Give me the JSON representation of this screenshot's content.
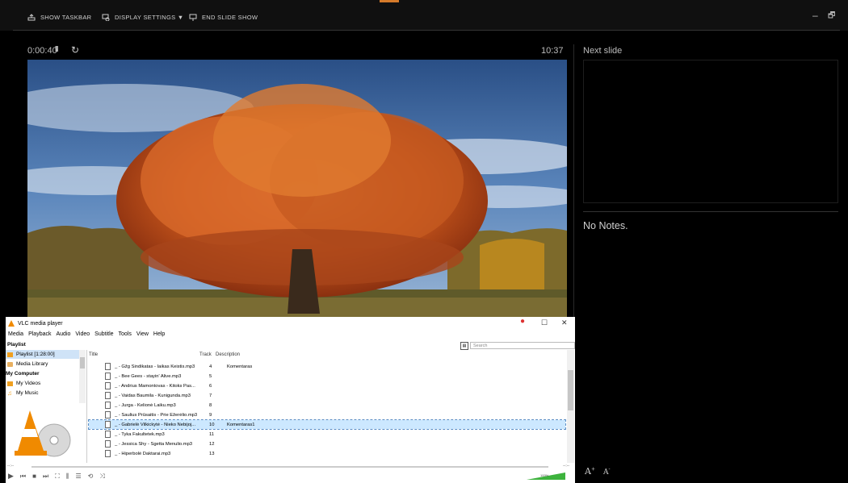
{
  "topbar": {
    "show_taskbar": "SHOW TASKBAR",
    "display_settings": "DISPLAY SETTINGS ▼",
    "end_slide_show": "END SLIDE SHOW",
    "minimize": "–",
    "restore": "🗗"
  },
  "presenter": {
    "timer": "0:00:40",
    "pause": "II",
    "restart": "↻",
    "clock": "10:37",
    "next_slide_label": "Next slide",
    "notes": "No Notes.",
    "font_increase": "A",
    "font_decrease": "A"
  },
  "vlc": {
    "title": "VLC media player",
    "close": "✕",
    "maximize": "☐",
    "menu": [
      "Media",
      "Playback",
      "Audio",
      "Video",
      "Subtitle",
      "Tools",
      "View",
      "Help"
    ],
    "playlist_label": "Playlist",
    "search_placeholder": "Search",
    "sidebar": {
      "playlist": "Playlist [1:28:00]",
      "media_library": "Media Library",
      "my_computer": "My Computer",
      "my_videos": "My Videos",
      "my_music": "My Music"
    },
    "columns": {
      "title": "Title",
      "track": "Track",
      "description": "Description"
    },
    "rows": [
      {
        "title": "_ - Gžg Sindikatas - Iaikas Keistis.mp3",
        "track": "4",
        "description": "Komentaras"
      },
      {
        "title": "_ - Bee Gees - stayin' Alive.mp3",
        "track": "5",
        "description": ""
      },
      {
        "title": "_ - Andrius Mamontovas - Kitoks Pas...",
        "track": "6",
        "description": ""
      },
      {
        "title": "_ - Vaidas Baumila - Kunigunda.mp3",
        "track": "7",
        "description": ""
      },
      {
        "title": "_ - Jurga - Kelionė Laiku.mp3",
        "track": "8",
        "description": ""
      },
      {
        "title": "_ - Saulius Prūsaitis - Prie Ežerėlio.mp3",
        "track": "9",
        "description": ""
      },
      {
        "title": "_ - Gabrielė Vilkickytė - Nieko Nebijoj...",
        "track": "10",
        "description": "Komentaras1",
        "selected": true
      },
      {
        "title": "_ - Tyka Fakultetek.mp3",
        "track": "11",
        "description": ""
      },
      {
        "title": "_ - Jessica Shy - Sgetta Menulio.mp3",
        "track": "12",
        "description": ""
      },
      {
        "title": "_ - Hiperbolė Daktarai.mp3",
        "track": "13",
        "description": ""
      }
    ],
    "seek_left": "--:--",
    "seek_right": "--:--",
    "volume": "100%"
  },
  "colors": {
    "accent": "#d47a2a",
    "selection": "#cce8ff",
    "vlc_orange": "#f08a00"
  }
}
